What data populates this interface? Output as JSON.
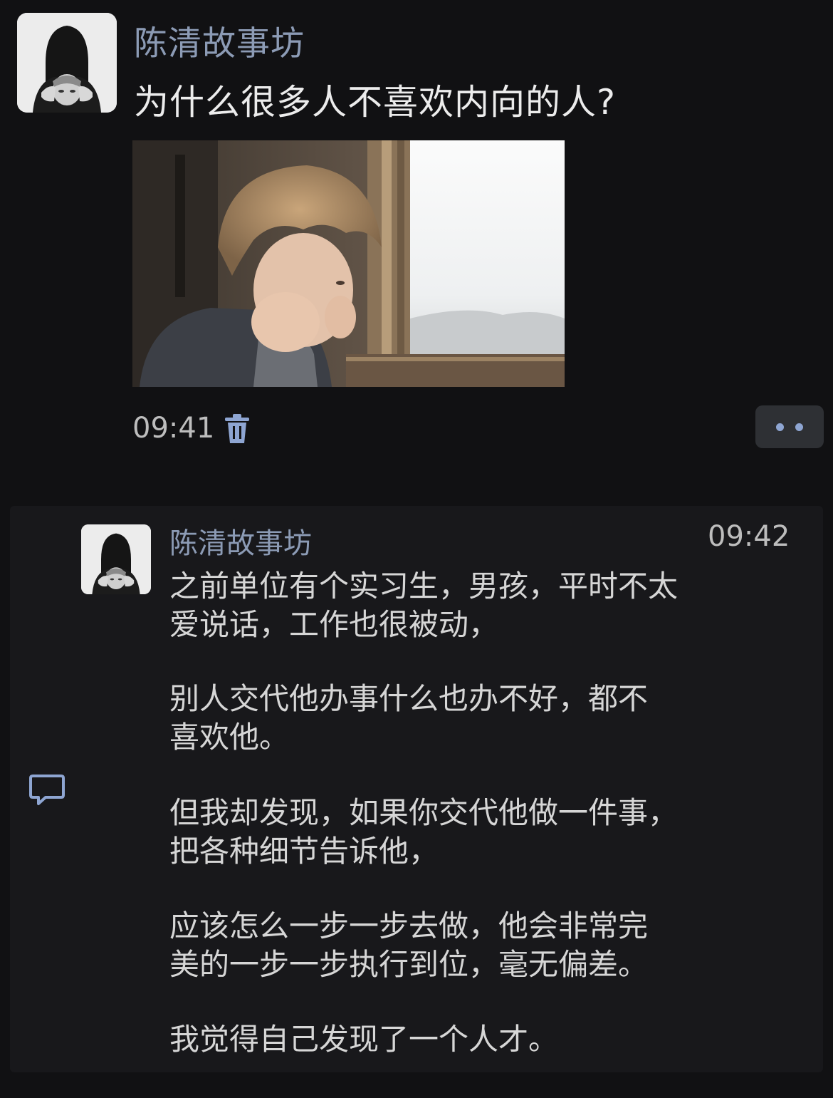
{
  "post": {
    "author": "陈清故事坊",
    "title": "为什么很多人不喜欢内向的人?",
    "time": "09:41",
    "image_desc_icon": "photo-child-window",
    "delete_icon": "trash-icon",
    "more_icon": "more-dots-icon"
  },
  "comment": {
    "author": "陈清故事坊",
    "time": "09:42",
    "reply_icon": "comment-bubble-icon",
    "paragraphs": [
      [
        "之前单位有个实习生，男孩，平时不太",
        "爱说话，工作也很被动，"
      ],
      [
        "别人交代他办事什么也办不好，都不",
        "喜欢他。"
      ],
      [
        "但我却发现，如果你交代他做一件事，",
        "把各种细节告诉他，"
      ],
      [
        "应该怎么一步一步去做，他会非常完",
        "美的一步一步执行到位，毫无偏差。"
      ],
      [
        "我觉得自己发现了一个人才。"
      ]
    ]
  },
  "colors": {
    "background": "#111113",
    "card": "#18181b",
    "author": "#8c9bb5",
    "accent": "#8ea5d2"
  }
}
